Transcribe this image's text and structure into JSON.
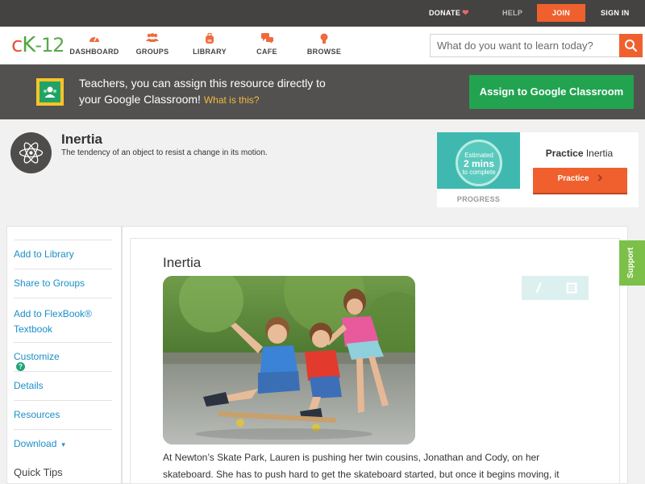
{
  "topbar": {
    "donate": "DONATE",
    "help": "HELP",
    "join": "JOIN",
    "signin": "SIGN IN"
  },
  "nav": {
    "logo_c": "c",
    "logo_k": "K",
    "logo_dash": "-",
    "logo_num": "12",
    "items": [
      {
        "label": "DASHBOARD",
        "icon": "gauge-icon"
      },
      {
        "label": "GROUPS",
        "icon": "people-icon"
      },
      {
        "label": "LIBRARY",
        "icon": "backpack-icon"
      },
      {
        "label": "CAFE",
        "icon": "chat-bubbles-icon"
      },
      {
        "label": "BROWSE",
        "icon": "lightbulb-icon"
      }
    ],
    "search_placeholder": "What do you want to learn today?"
  },
  "classroom": {
    "line1": "Teachers, you can assign this resource directly to",
    "line2": "your Google Classroom!",
    "what": "What is this?",
    "button": "Assign to Google Classroom"
  },
  "concept": {
    "title": "Inertia",
    "description": "The tendency of an object to resist a change in its motion."
  },
  "practice": {
    "estimated": "Estimated",
    "mins": "2 mins",
    "to_complete": "to complete",
    "progress_label": "PROGRESS",
    "title_bold": "Practice",
    "title_rest": " Inertia",
    "button": "Practice"
  },
  "sidebar": {
    "items": [
      {
        "label": "Add to Library"
      },
      {
        "label": "Share to Groups"
      },
      {
        "label": "Add to FlexBook®",
        "label2": "Textbook"
      },
      {
        "label": "Customize"
      },
      {
        "label": "Details"
      },
      {
        "label": "Resources"
      },
      {
        "label": "Download"
      }
    ],
    "customize_badge": "?",
    "download_caret": "▾",
    "quick_tips": "Quick Tips"
  },
  "content": {
    "title": "Inertia",
    "paragraph_line1": "At Newton’s Skate Park, Lauren is pushing her twin cousins, Jonathan and Cody, on her",
    "paragraph_line2": "skateboard. She has to push hard to get the skateboard started, but once it begins moving, it"
  },
  "support": "Support",
  "colors": {
    "accent": "#f0602e",
    "link": "#1b8fc8",
    "green": "#22a350",
    "topbar": "#444341"
  }
}
